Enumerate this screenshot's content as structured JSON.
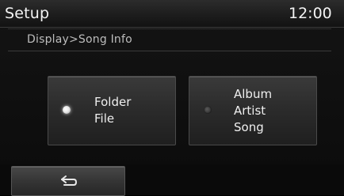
{
  "header": {
    "title": "Setup",
    "clock": "12:00"
  },
  "breadcrumb": {
    "path": "Display>Song Info"
  },
  "options": [
    {
      "lines": [
        "Folder",
        "File"
      ],
      "selected": true
    },
    {
      "lines": [
        "Album",
        "Artist",
        "Song"
      ],
      "selected": false
    }
  ],
  "footer": {
    "back_icon": "back-arrow-icon"
  }
}
